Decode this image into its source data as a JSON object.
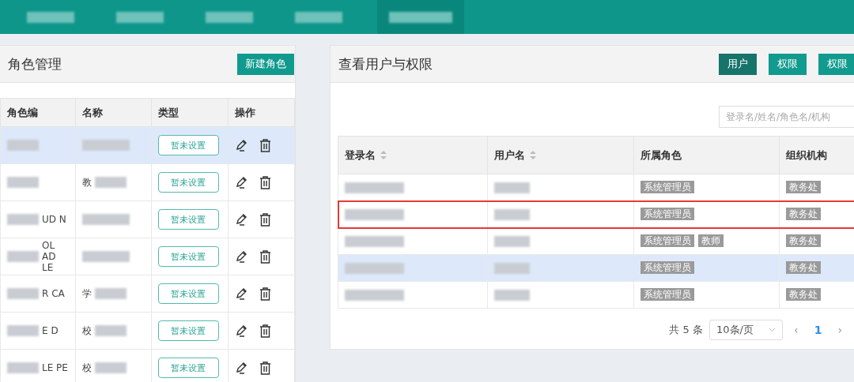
{
  "nav_items": [
    {
      "selected": false
    },
    {
      "selected": false
    },
    {
      "selected": false
    },
    {
      "selected": false
    },
    {
      "selected": true
    }
  ],
  "role_panel": {
    "title": "角色管理",
    "new_button": "新建角色",
    "columns": [
      "角色编",
      "名称",
      "类型",
      "操作"
    ],
    "rows": [
      {
        "highlighted": true,
        "type_button": "暂未设置"
      },
      {
        "highlighted": false,
        "name": "教",
        "type_button": "暂未设置"
      },
      {
        "highlighted": false,
        "code": "UD N",
        "type_button": "暂未设置"
      },
      {
        "highlighted": false,
        "code": "OL AD LE",
        "type_button": "暂未设置"
      },
      {
        "highlighted": false,
        "code": "R CA",
        "name": "学",
        "type_button": "暂未设置"
      },
      {
        "highlighted": false,
        "code": "E D",
        "name": "校",
        "type_button": "暂未设置"
      },
      {
        "highlighted": false,
        "code": "LE PE",
        "name": "校",
        "type_button": "暂未设置"
      }
    ]
  },
  "user_panel": {
    "title": "查看用户与权限",
    "tabs": [
      {
        "label": "用户",
        "selected": true
      },
      {
        "label": "权限",
        "selected": false
      },
      {
        "label": "权限",
        "selected": false
      }
    ],
    "search": {
      "placeholder": "登录名/姓名/角色名/机构"
    },
    "columns": [
      {
        "label": "登录名",
        "sortable": true
      },
      {
        "label": "用户名",
        "sortable": true
      },
      {
        "label": "所属角色",
        "sortable": false
      },
      {
        "label": "组织机构",
        "sortable": false
      }
    ],
    "rows": [
      {
        "highlighted": false,
        "marked": false,
        "roles": [
          "系统管理员"
        ],
        "org": "教务处"
      },
      {
        "highlighted": false,
        "marked": true,
        "roles": [
          "系统管理员"
        ],
        "org": "教务处"
      },
      {
        "highlighted": false,
        "marked": false,
        "roles": [
          "系统管理员",
          "教师"
        ],
        "org": "教务处"
      },
      {
        "highlighted": true,
        "marked": false,
        "roles": [
          "系统管理员"
        ],
        "org": "教务处"
      },
      {
        "highlighted": false,
        "marked": false,
        "roles": [
          "系统管理员"
        ],
        "org": "教务处"
      }
    ],
    "pagination": {
      "total": "共 5 条",
      "page_size": "10条/页",
      "prev": "‹",
      "page": "1",
      "next": "›"
    }
  }
}
